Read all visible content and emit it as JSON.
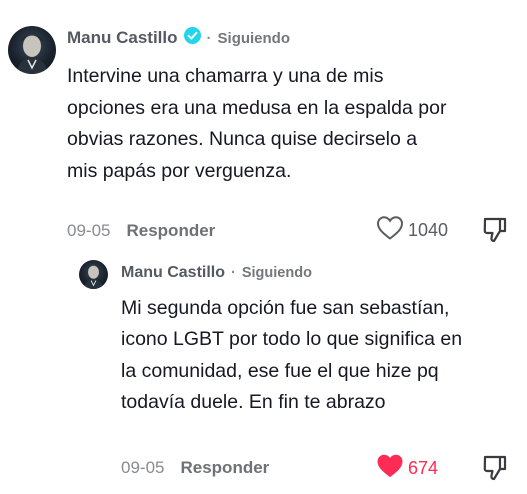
{
  "comment": {
    "author": "Manu Castillo",
    "verified": true,
    "separator": "·",
    "follow_status": "Siguiendo",
    "text": "Intervine una chamarra y una de mis opciones era una medusa en la espalda por obvias razones. Nunca quise decirselo a mis papás por verguenza.",
    "date": "09-05",
    "reply_label": "Responder",
    "like_count": "1040",
    "liked": false,
    "icons": {
      "verified": "verified-badge-icon",
      "like": "heart-outline-icon",
      "dislike": "thumbs-down-icon"
    }
  },
  "reply": {
    "author": "Manu Castillo",
    "separator": "·",
    "follow_status": "Siguiendo",
    "text": "Mi segunda opción fue san sebastían, icono LGBT por todo lo que significa en la comunidad, ese fue el que hize pq todavía duele. En fin te abrazo",
    "date": "09-05",
    "reply_label": "Responder",
    "like_count": "674",
    "liked": true,
    "icons": {
      "like": "heart-filled-icon",
      "dislike": "thumbs-down-icon"
    }
  },
  "colors": {
    "verified_blue": "#20d5ec",
    "like_red": "#fe2c55",
    "text": "#161823",
    "secondary": "#8a8b91"
  }
}
